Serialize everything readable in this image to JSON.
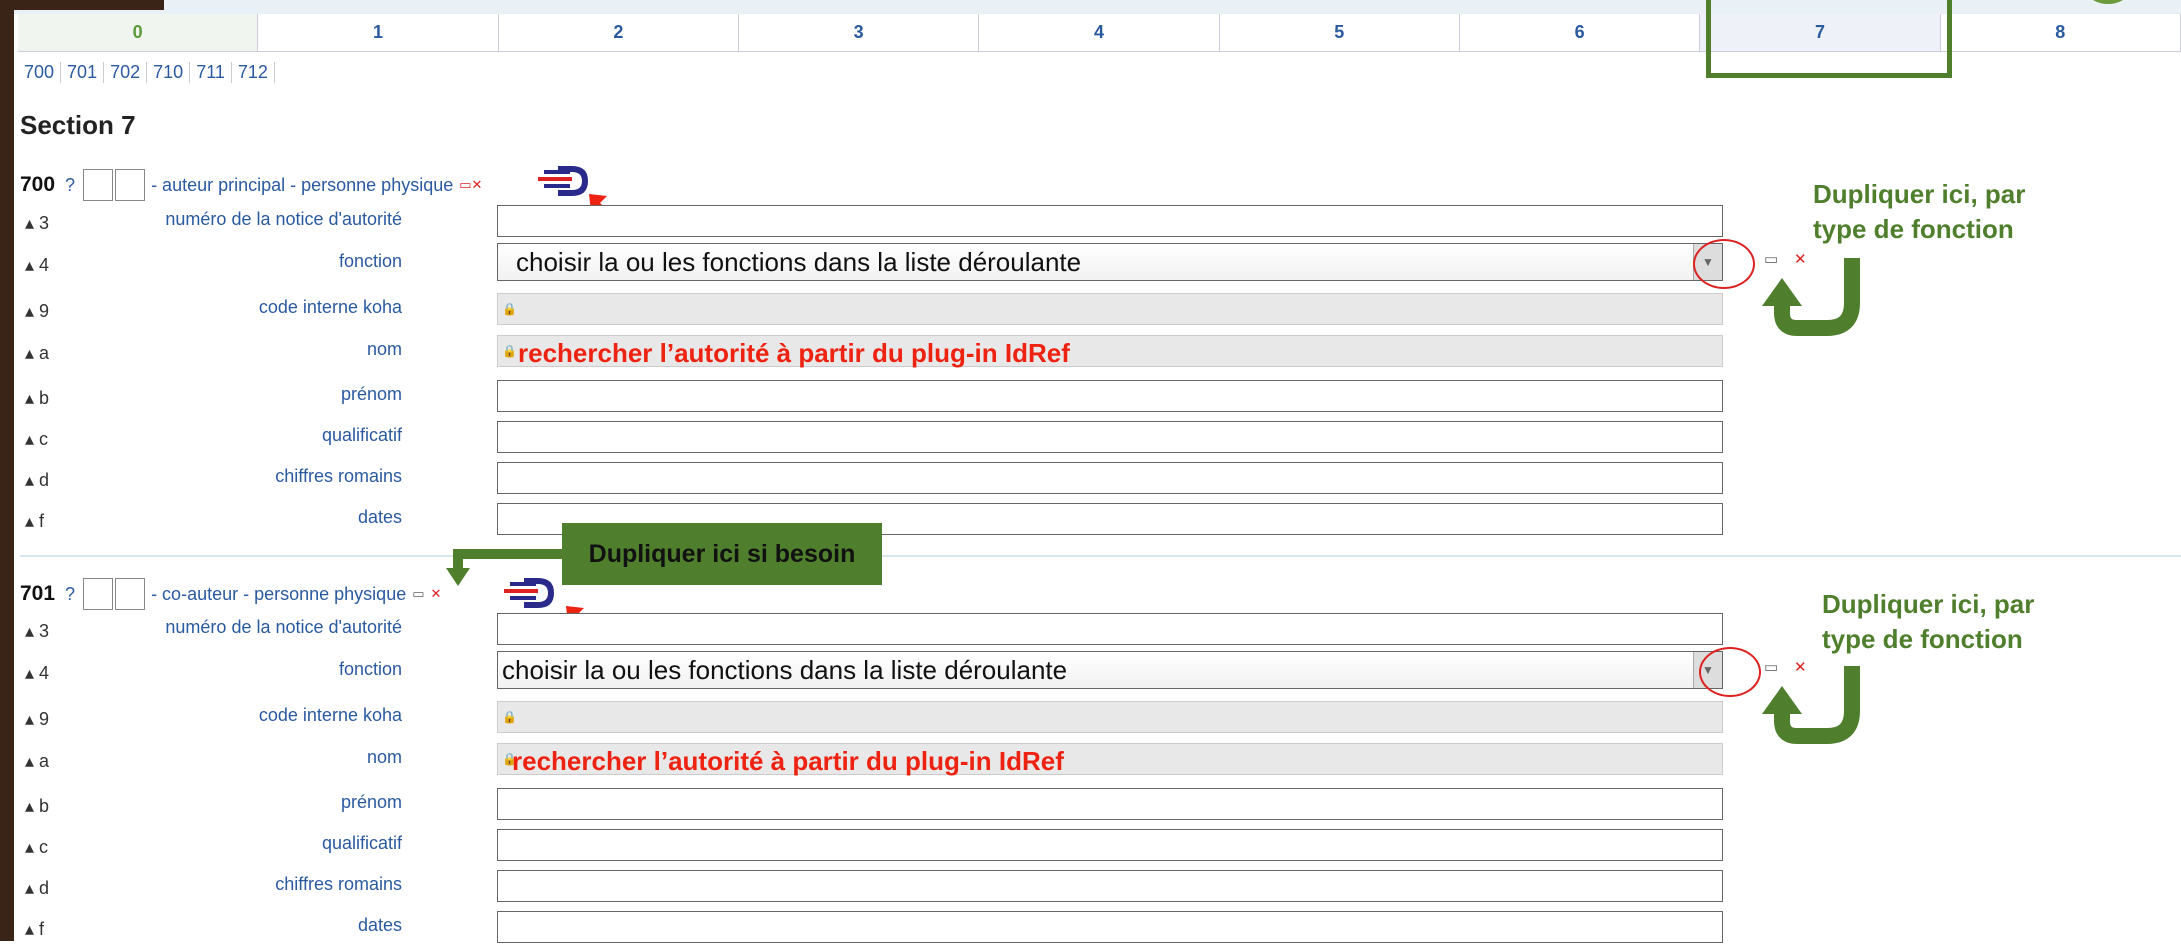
{
  "tabs": [
    "0",
    "1",
    "2",
    "3",
    "4",
    "5",
    "6",
    "7",
    "8"
  ],
  "active_tab": "7",
  "subtabs": [
    "700",
    "701",
    "702",
    "710",
    "711",
    "712"
  ],
  "section_title": "Section 7",
  "block700": {
    "tag": "700",
    "help": "?",
    "description": "- auteur principal - personne physique",
    "rows": [
      {
        "code": "3",
        "label": "numéro de la notice d'autorité",
        "value": ""
      },
      {
        "code": "4",
        "label": "fonction",
        "value": "choisir la ou les fonctions dans la liste déroulante"
      },
      {
        "code": "9",
        "label": "code interne koha",
        "value": ""
      },
      {
        "code": "a",
        "label": "nom",
        "value": "rechercher l’autorité à partir du plug-in IdRef"
      },
      {
        "code": "b",
        "label": "prénom",
        "value": ""
      },
      {
        "code": "c",
        "label": "qualificatif",
        "value": ""
      },
      {
        "code": "d",
        "label": "chiffres romains",
        "value": ""
      },
      {
        "code": "f",
        "label": "dates",
        "value": ""
      }
    ]
  },
  "block701": {
    "tag": "701",
    "help": "?",
    "description": "- co-auteur - personne physique",
    "rows": [
      {
        "code": "3",
        "label": "numéro de la notice d'autorité",
        "value": ""
      },
      {
        "code": "4",
        "label": "fonction",
        "value": "choisir la ou les fonctions dans la liste déroulante"
      },
      {
        "code": "9",
        "label": "code interne koha",
        "value": ""
      },
      {
        "code": "a",
        "label": "nom",
        "value": "rechercher l’autorité à partir du plug-in IdRef"
      },
      {
        "code": "b",
        "label": "prénom",
        "value": ""
      },
      {
        "code": "c",
        "label": "qualificatif",
        "value": ""
      },
      {
        "code": "d",
        "label": "chiffres romains",
        "value": ""
      },
      {
        "code": "f",
        "label": "dates",
        "value": ""
      }
    ]
  },
  "annotations": {
    "duplicate_function_1": "Dupliquer ici, par",
    "duplicate_function_2": "type de fonction",
    "duplicate_if_needed": "Dupliquer ici si besoin"
  },
  "colors": {
    "annotation_green": "#4f7f2c",
    "annotation_red": "#e21",
    "link_blue": "#2a5aa0"
  }
}
